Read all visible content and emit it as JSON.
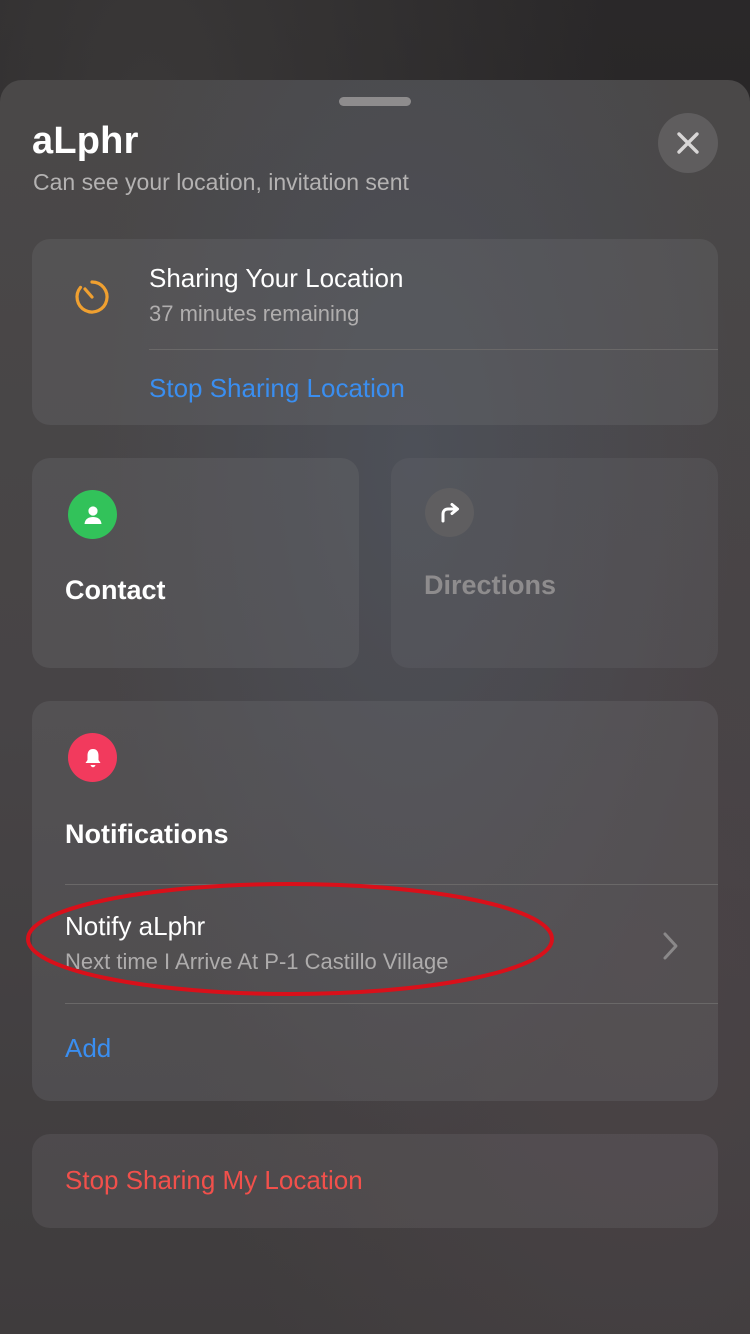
{
  "header": {
    "name": "aLphr",
    "status": "Can see your location, invitation sent"
  },
  "sharing": {
    "title": "Sharing Your Location",
    "remaining": "37 minutes remaining",
    "stop_label": "Stop Sharing Location"
  },
  "actions": {
    "contact_label": "Contact",
    "directions_label": "Directions"
  },
  "notifications": {
    "heading": "Notifications",
    "item": {
      "title": "Notify aLphr",
      "subtitle": "Next time I Arrive At P-1 Castillo Village"
    },
    "add_label": "Add"
  },
  "footer": {
    "stop_my_location_label": "Stop Sharing My Location"
  },
  "icons": {
    "timer": "timer-icon",
    "contact": "person-icon",
    "directions": "turn-right-arrow-icon",
    "notifications": "bell-icon",
    "close": "close-icon",
    "chevron": "chevron-right-icon"
  },
  "colors": {
    "accent_blue": "#3a8ef0",
    "destructive_red": "#f2504b",
    "timer_orange": "#f0a030",
    "contact_green": "#32c25a",
    "bell_pink": "#f23a5d",
    "annotation_red": "#d9101a"
  }
}
